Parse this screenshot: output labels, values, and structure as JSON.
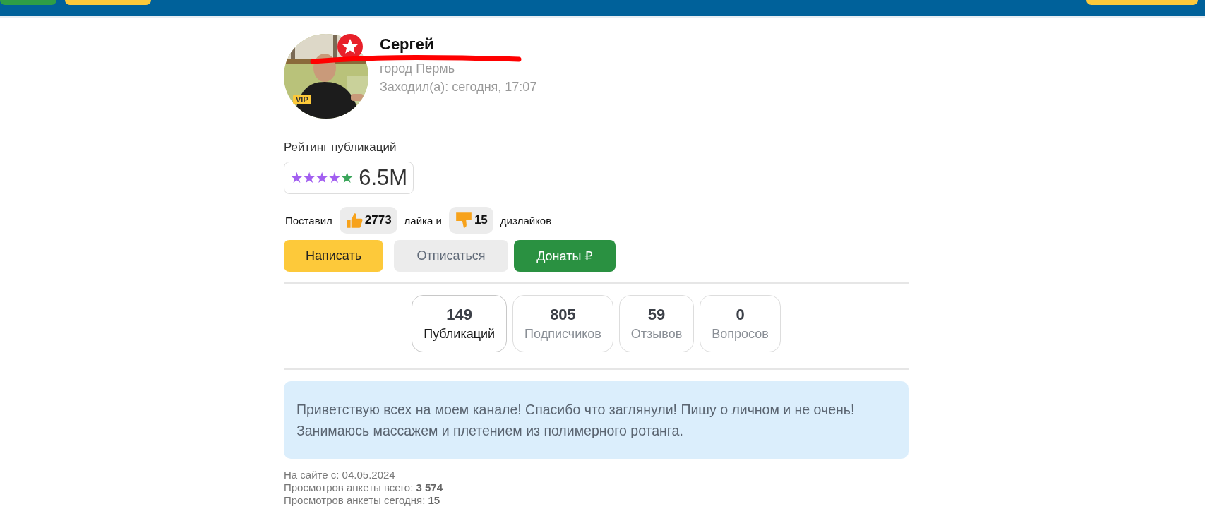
{
  "profile": {
    "name": "Сергей",
    "city": "город  Пермь",
    "last_seen": "Заходил(а): сегодня, 17:07",
    "badge": "VIP"
  },
  "rating": {
    "label": "Рейтинг публикаций",
    "stars": 4,
    "value": "6.5M"
  },
  "votes": {
    "prefix": "Поставил",
    "likes": "2773",
    "middle": "лайка  и",
    "dislikes": "15",
    "suffix": "дизлайков"
  },
  "buttons": [
    {
      "label": "Написать",
      "kind": "primary"
    },
    {
      "label": "Отписаться",
      "kind": "secondary"
    },
    {
      "label": "Донаты ₽",
      "kind": "donate"
    }
  ],
  "stats": [
    {
      "value": "149",
      "label": "Публикаций",
      "selected": true
    },
    {
      "value": "805",
      "label": "Подписчиков",
      "selected": false
    },
    {
      "value": "59",
      "label": "Отзывов",
      "selected": false
    },
    {
      "value": "0",
      "label": "Вопросов",
      "selected": false
    }
  ],
  "bio": "Приветствую всех на моем канале! Спасибо что заглянули! Пишу о личном и не очень! Занимаюсь массажем и плетением из полимерного ротанга.",
  "footer": [
    "На сайте с: 04.05.2024",
    "Просмотров анкеты всего: **3 574**",
    "Просмотров анкеты сегодня: **15**"
  ]
}
